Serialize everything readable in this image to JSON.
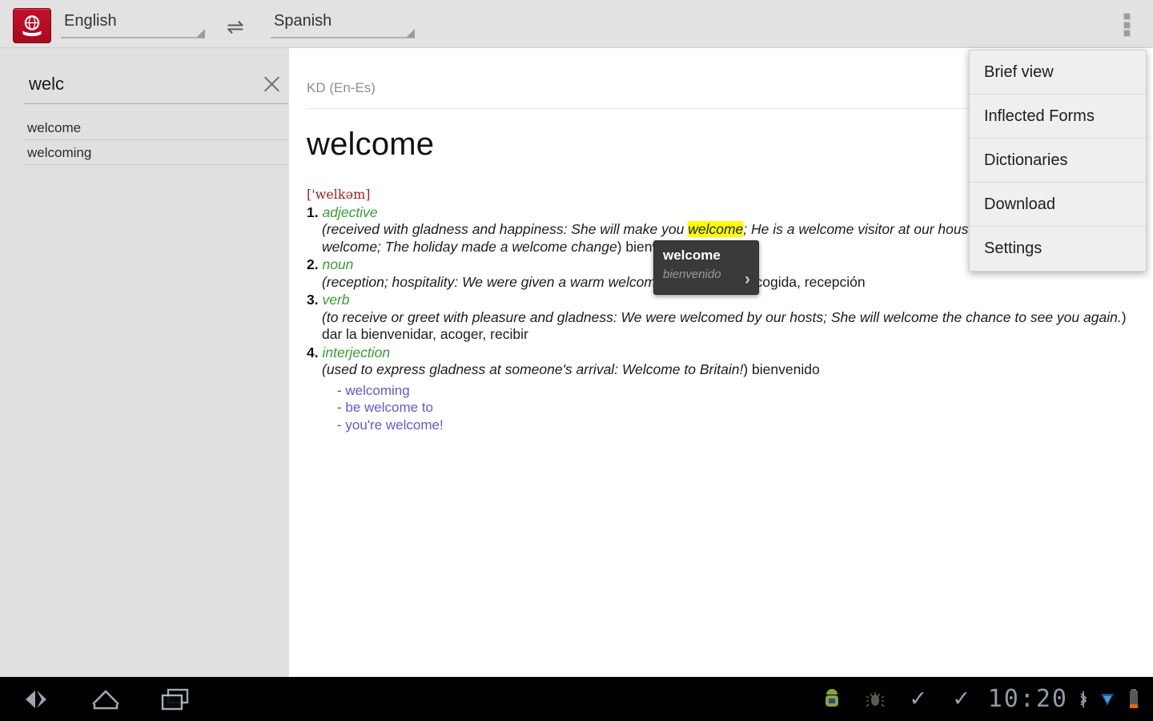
{
  "topbar": {
    "app_icon": "dictionary-globe-book-icon",
    "source_language": "English",
    "target_language": "Spanish",
    "swap_icon": "⇌",
    "overflow_menu_icon": "three-dots-icon"
  },
  "search": {
    "value": "welc",
    "placeholder": "",
    "clear_icon": "close-x-icon",
    "suggestions": [
      "welcome",
      "welcoming"
    ]
  },
  "menu": {
    "items": [
      "Brief view",
      "Inflected Forms",
      "Dictionaries",
      "Download",
      "Settings"
    ]
  },
  "article": {
    "dictionary": "KD (En-Es)",
    "headword": "welcome",
    "transcription": "['welkəm]",
    "senses": [
      {
        "num": "1.",
        "pos": "adjective",
        "open": "(",
        "definition": "received with gladness and happiness: She will make you ",
        "highlight": "welcome",
        "definition_rest": "; He is a welcome visitor at our house; The money was very welcome; The holiday made a welcome change",
        "close": ")",
        "translation": " bienvenido"
      },
      {
        "num": "2.",
        "pos": "noun",
        "open": "(",
        "definition": "reception; hospitality: We were given a warm welcome",
        "highlight": "",
        "definition_rest": "",
        "close": ")",
        "translation": " bienvenida, acogida, recepción"
      },
      {
        "num": "3.",
        "pos": "verb",
        "open": "(",
        "definition": "to receive or greet with pleasure and gladness: We were welcomed by our hosts; She will welcome the chance to see you again.",
        "highlight": "",
        "definition_rest": "",
        "close": ")",
        "translation": " dar la bienvenidar, acoger, recibir"
      },
      {
        "num": "4.",
        "pos": "interjection",
        "open": "(",
        "definition": "used to express gladness at someone's arrival: Welcome to Britain!",
        "highlight": "",
        "definition_rest": "",
        "close": ")",
        "translation": " bienvenido"
      }
    ],
    "related_links": [
      "welcoming",
      "be welcome to",
      "you're welcome!"
    ]
  },
  "tooltip": {
    "word": "welcome",
    "translation": "bienvenido",
    "arrow_icon": "chevron-right-icon"
  },
  "systembar": {
    "back_icon": "back-arrow-icon",
    "home_icon": "home-icon",
    "recents_icon": "recent-apps-icon",
    "android_icon": "android-robot-icon",
    "debug_icon": "usb-debug-icon",
    "check1_icon": "check-icon",
    "check2_icon": "check-icon",
    "clock": "10:20",
    "bluetooth_icon": "bluetooth-icon",
    "signal_icon": "signal-icon",
    "battery_icon": "battery-icon"
  },
  "colors": {
    "brand_red": "#c4112a",
    "pos_green": "#3a9b3a",
    "ipa_red": "#9b2222",
    "link_blue": "#5b5bdc",
    "highlight_yellow": "#ffff00",
    "panel_gray": "#e0e0e0"
  }
}
